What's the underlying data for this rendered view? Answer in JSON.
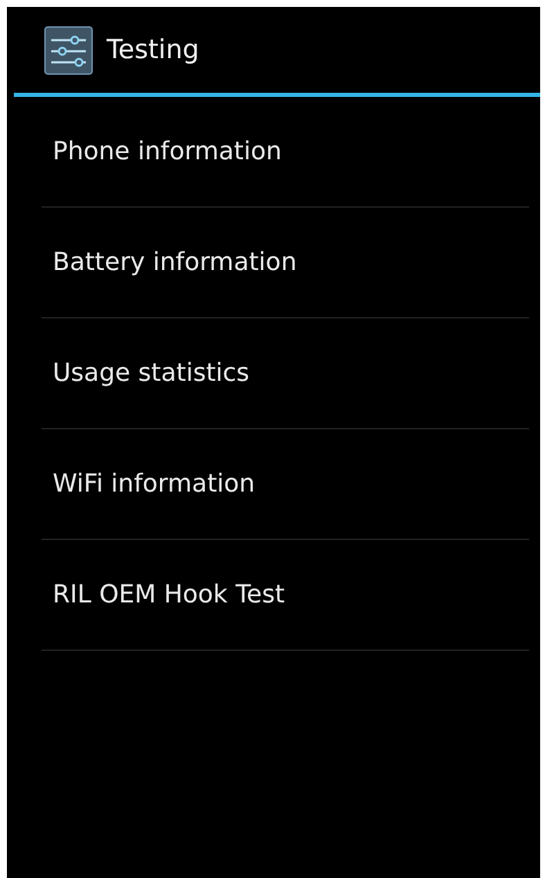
{
  "action_bar": {
    "title": "Testing"
  },
  "items": [
    {
      "label": "Phone information"
    },
    {
      "label": "Battery information"
    },
    {
      "label": "Usage statistics"
    },
    {
      "label": "WiFi information"
    },
    {
      "label": "RIL OEM Hook Test"
    }
  ]
}
